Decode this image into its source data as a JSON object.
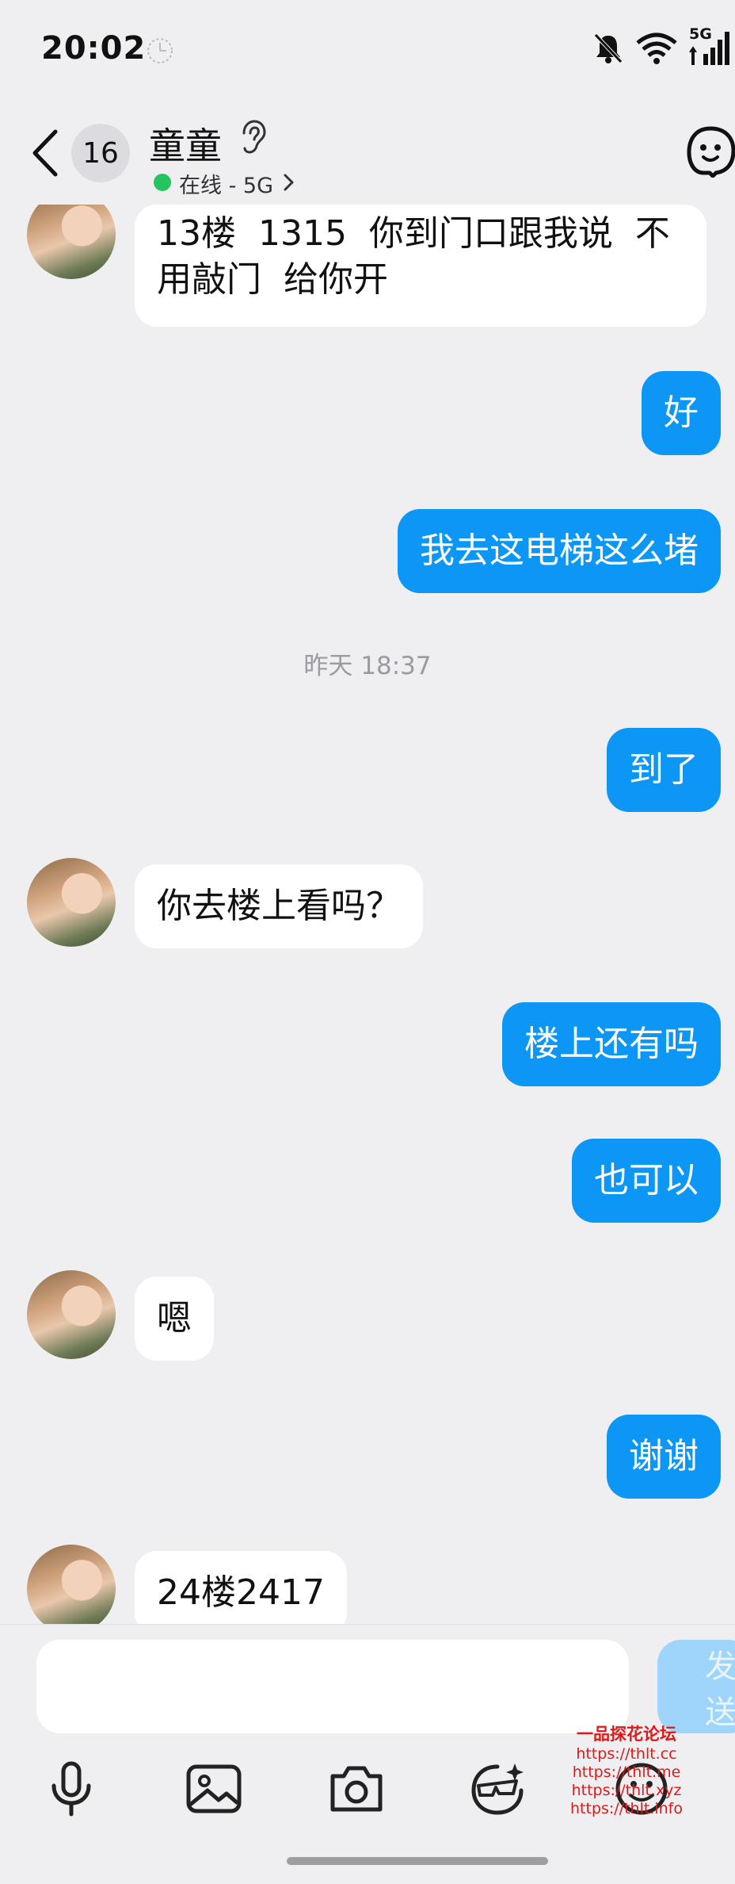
{
  "status_bar": {
    "time": "20:02",
    "network": "5G",
    "icons": [
      "clock-icon",
      "mute-bell-icon",
      "wifi-icon",
      "signal-icon"
    ]
  },
  "header": {
    "unread_count": "16",
    "contact_name": "童童",
    "online_status": "在线 - 5G",
    "icons": [
      "back-arrow-icon",
      "ear-icon",
      "chevron-right-icon",
      "smiley-face-icon"
    ]
  },
  "messages": [
    {
      "side": "in",
      "text": "13楼  1315  你到门口跟我说  不\n用敲门  给你开"
    },
    {
      "side": "out",
      "text": "好"
    },
    {
      "side": "out",
      "text": "我去这电梯这么堵"
    },
    {
      "side": "time",
      "text": "昨天 18:37"
    },
    {
      "side": "out",
      "text": "到了"
    },
    {
      "side": "in",
      "text": "你去楼上看吗？"
    },
    {
      "side": "out",
      "text": "楼上还有吗"
    },
    {
      "side": "out",
      "text": "也可以"
    },
    {
      "side": "in",
      "text": "嗯"
    },
    {
      "side": "out",
      "text": "谢谢"
    },
    {
      "side": "in",
      "text": "24楼2417"
    }
  ],
  "input": {
    "value": "",
    "placeholder": "",
    "send_label": "发送"
  },
  "toolbar": [
    "microphone-icon",
    "image-icon",
    "camera-icon",
    "sticker-icon",
    "emoji-icon"
  ],
  "watermark": {
    "title": "一品探花论坛",
    "lines": [
      "https://thlt.cc",
      "https://thlt.me",
      "https://thlt.xyz",
      "https://thlt.info"
    ]
  },
  "colors": {
    "outgoing_bubble": "#0c97f7",
    "incoming_bubble": "#ffffff",
    "background": "#efeff2",
    "online_dot": "#22c55e",
    "watermark": "#e01818"
  }
}
